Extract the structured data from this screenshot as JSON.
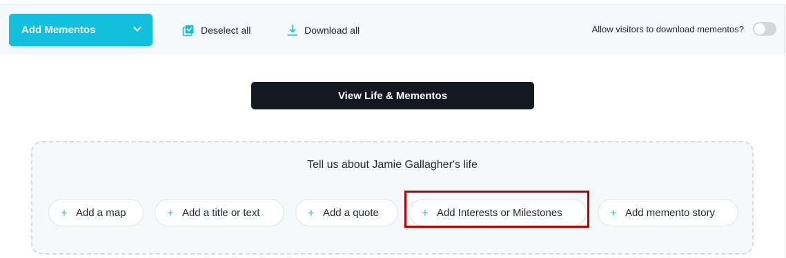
{
  "toolbar": {
    "add_mementos_label": "Add Mementos",
    "deselect_all_label": "Deselect all",
    "download_all_label": "Download all",
    "allow_download_label": "Allow visitors to download mementos?",
    "allow_download_enabled": false
  },
  "view_button_label": "View Life & Mementos",
  "prompt": {
    "title": "Tell us about Jamie Gallagher's life",
    "options": [
      {
        "label": "Add a map"
      },
      {
        "label": "Add a title or text"
      },
      {
        "label": "Add a quote"
      },
      {
        "label": "Add Interests or Milestones",
        "highlighted": true
      },
      {
        "label": "Add memento story"
      }
    ]
  },
  "colors": {
    "accent": "#12bfdc",
    "dark_button": "#141821",
    "highlight": "#b80000",
    "toolbar_bg": "#f5f9fc",
    "panel_bg": "#f6f8fa"
  },
  "icons": {
    "dropdown": "chevron-down-icon",
    "deselect": "checkbox-stack-icon",
    "download": "download-icon",
    "add": "plus-icon"
  }
}
